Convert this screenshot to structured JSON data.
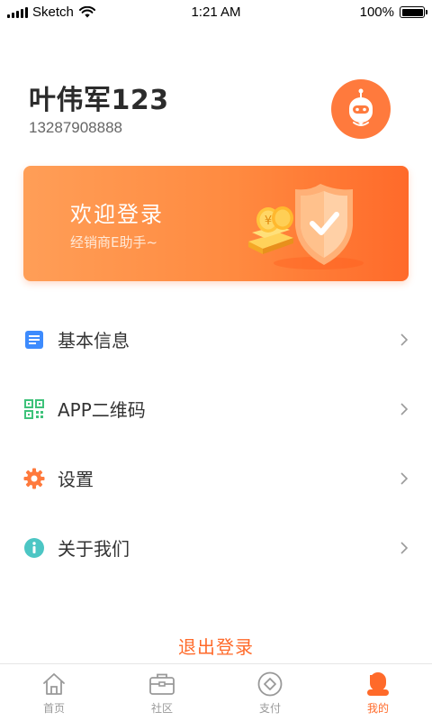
{
  "status_bar": {
    "carrier": "Sketch",
    "time": "1:21 AM",
    "battery": "100%"
  },
  "profile": {
    "name": "叶伟军123",
    "phone": "13287908888",
    "avatar_icon": "robot-avatar-icon"
  },
  "banner": {
    "title": "欢迎登录",
    "subtitle": "经销商E助手~",
    "art_icon": "shield-coins-illustration"
  },
  "menu": {
    "items": [
      {
        "label": "基本信息",
        "icon": "document-icon",
        "icon_color": "#3d8bfd"
      },
      {
        "label": "APP二维码",
        "icon": "qr-code-icon",
        "icon_color": "#3ec27a"
      },
      {
        "label": "设置",
        "icon": "gear-icon",
        "icon_color": "#ff7a3d"
      },
      {
        "label": "关于我们",
        "icon": "info-icon",
        "icon_color": "#4cc6c4"
      }
    ]
  },
  "logout_label": "退出登录",
  "tab_bar": {
    "tabs": [
      {
        "label": "首页",
        "icon": "home-icon",
        "active": false
      },
      {
        "label": "社区",
        "icon": "briefcase-icon",
        "active": false
      },
      {
        "label": "支付",
        "icon": "payment-icon",
        "active": false
      },
      {
        "label": "我的",
        "icon": "user-icon",
        "active": true
      }
    ]
  },
  "colors": {
    "accent": "#ff6a2a",
    "banner_start": "#ff9e57",
    "banner_end": "#ff6a2a",
    "inactive_tab": "#999999"
  }
}
